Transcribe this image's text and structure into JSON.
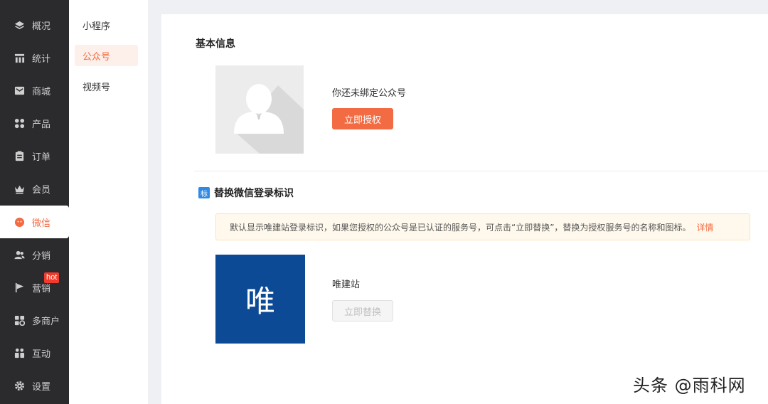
{
  "sidebar": {
    "items": [
      {
        "label": "概况",
        "icon": "layers-icon"
      },
      {
        "label": "统计",
        "icon": "bar-chart-icon"
      },
      {
        "label": "商城",
        "icon": "mail-icon"
      },
      {
        "label": "产品",
        "icon": "grid-icon"
      },
      {
        "label": "订单",
        "icon": "clipboard-icon"
      },
      {
        "label": "会员",
        "icon": "crown-icon"
      },
      {
        "label": "微信",
        "icon": "wechat-icon",
        "active": true
      },
      {
        "label": "分销",
        "icon": "users-icon"
      },
      {
        "label": "营销",
        "icon": "flag-icon",
        "badge": "hot"
      },
      {
        "label": "多商户",
        "icon": "store-icon"
      },
      {
        "label": "互动",
        "icon": "interact-icon"
      },
      {
        "label": "设置",
        "icon": "gear-icon"
      }
    ]
  },
  "submenu": {
    "items": [
      {
        "label": "小程序"
      },
      {
        "label": "公众号",
        "active": true
      },
      {
        "label": "视频号"
      }
    ]
  },
  "basic_info": {
    "title": "基本信息",
    "unbound_text": "你还未绑定公众号",
    "authorize_button": "立即授权"
  },
  "login_mark": {
    "tag": "标",
    "title": "替换微信登录标识",
    "notice": "默认显示唯建站登录标识，如果您授权的公众号是已认证的服务号，可点击“立即替换”，替换为授权服务号的名称和图标。",
    "detail_link": "详情",
    "logo_char": "唯",
    "site_name": "唯建站",
    "replace_button": "立即替换"
  },
  "watermark": "头条 @雨科网",
  "colors": {
    "accent": "#f26b42",
    "sidebar_bg": "#2b2b2e",
    "logo_bg": "#0d4a96",
    "tag_blue": "#2f8ae5"
  }
}
